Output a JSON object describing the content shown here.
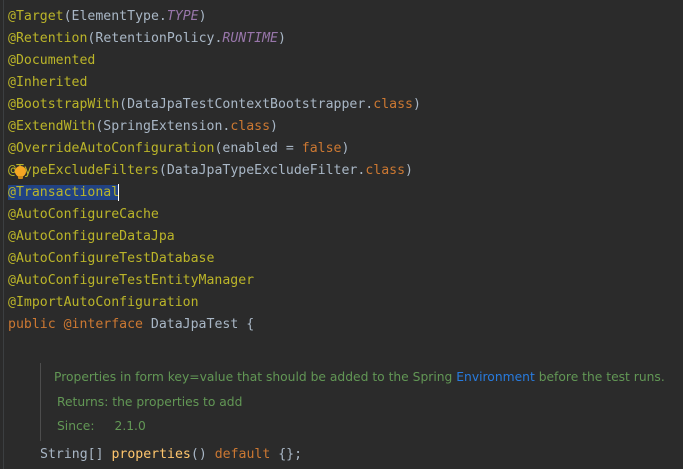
{
  "editor": {
    "lines": [
      {
        "at": "@",
        "name": "Target",
        "open": "(",
        "arg1": "ElementType.",
        "arg2": "TYPE",
        "close": ")"
      },
      {
        "at": "@",
        "name": "Retention",
        "open": "(",
        "arg1": "RetentionPolicy.",
        "arg2": "RUNTIME",
        "close": ")"
      },
      {
        "text": "@Documented"
      },
      {
        "text": "@Inherited"
      },
      {
        "name": "@BootstrapWith",
        "open": "(",
        "arg1": "DataJpaTestContextBootstrapper.",
        "arg2": "class",
        "close": ")"
      },
      {
        "name": "@ExtendWith",
        "open": "(",
        "arg1": "SpringExtension.",
        "arg2": "class",
        "close": ")"
      },
      {
        "name": "@OverrideAutoConfiguration",
        "open": "(",
        "arg1": "enabled = ",
        "arg2": "false",
        "close": ")"
      },
      {
        "name": "@TypeExcludeFilters",
        "open": "(",
        "arg1": "DataJpaTypeExcludeFilter.",
        "arg2": "class",
        "close": ")"
      },
      {
        "text": "@Transactional"
      },
      {
        "text": "@AutoConfigureCache"
      },
      {
        "text": "@AutoConfigureDataJpa"
      },
      {
        "text": "@AutoConfigureTestDatabase"
      },
      {
        "text": "@AutoConfigureTestEntityManager"
      },
      {
        "text": "@ImportAutoConfiguration"
      },
      {
        "kw": "public ",
        "kw2": "@interface ",
        "name": "DataJpaTest",
        "brace": " {"
      }
    ],
    "javadoc": {
      "text_before": "Properties in form key=value that should be added to the Spring ",
      "link": "Environment",
      "text_after": " before the test runs.",
      "returns": "Returns: the properties to add",
      "since_label": "Since:",
      "since_value": "2.1.0"
    },
    "method": {
      "type": "String[] ",
      "name": "properties",
      "parens": "() ",
      "kw": "default",
      "rest": " {};"
    }
  }
}
